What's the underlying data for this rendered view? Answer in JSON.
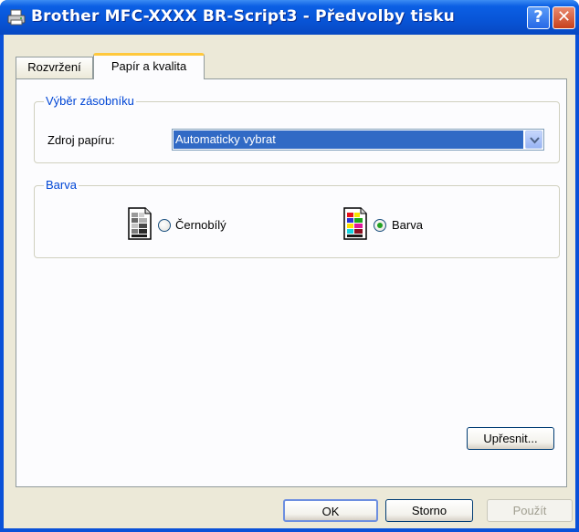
{
  "window": {
    "title": "Brother MFC-XXXX BR-Script3 - Předvolby tisku",
    "help_label": "?",
    "close_label": "✕"
  },
  "tabs": [
    {
      "label": "Rozvržení",
      "selected": false
    },
    {
      "label": "Papír a kvalita",
      "selected": true
    }
  ],
  "tray_group": {
    "legend": "Výběr zásobníku",
    "source_label": "Zdroj papíru:",
    "source_value": "Automaticky vybrat"
  },
  "color_group": {
    "legend": "Barva",
    "options": [
      {
        "label": "Černobílý",
        "icon": "grayscale-page-icon",
        "selected": false
      },
      {
        "label": "Barva",
        "icon": "color-page-icon",
        "selected": true
      }
    ]
  },
  "buttons": {
    "advanced": "Upřesnit...",
    "ok": "OK",
    "cancel": "Storno",
    "apply": "Použít"
  },
  "colors": {
    "title_bar": "#0854d6",
    "dialog_bg": "#ece9d8",
    "group_legend": "#0046d5",
    "selection": "#316ac5"
  }
}
